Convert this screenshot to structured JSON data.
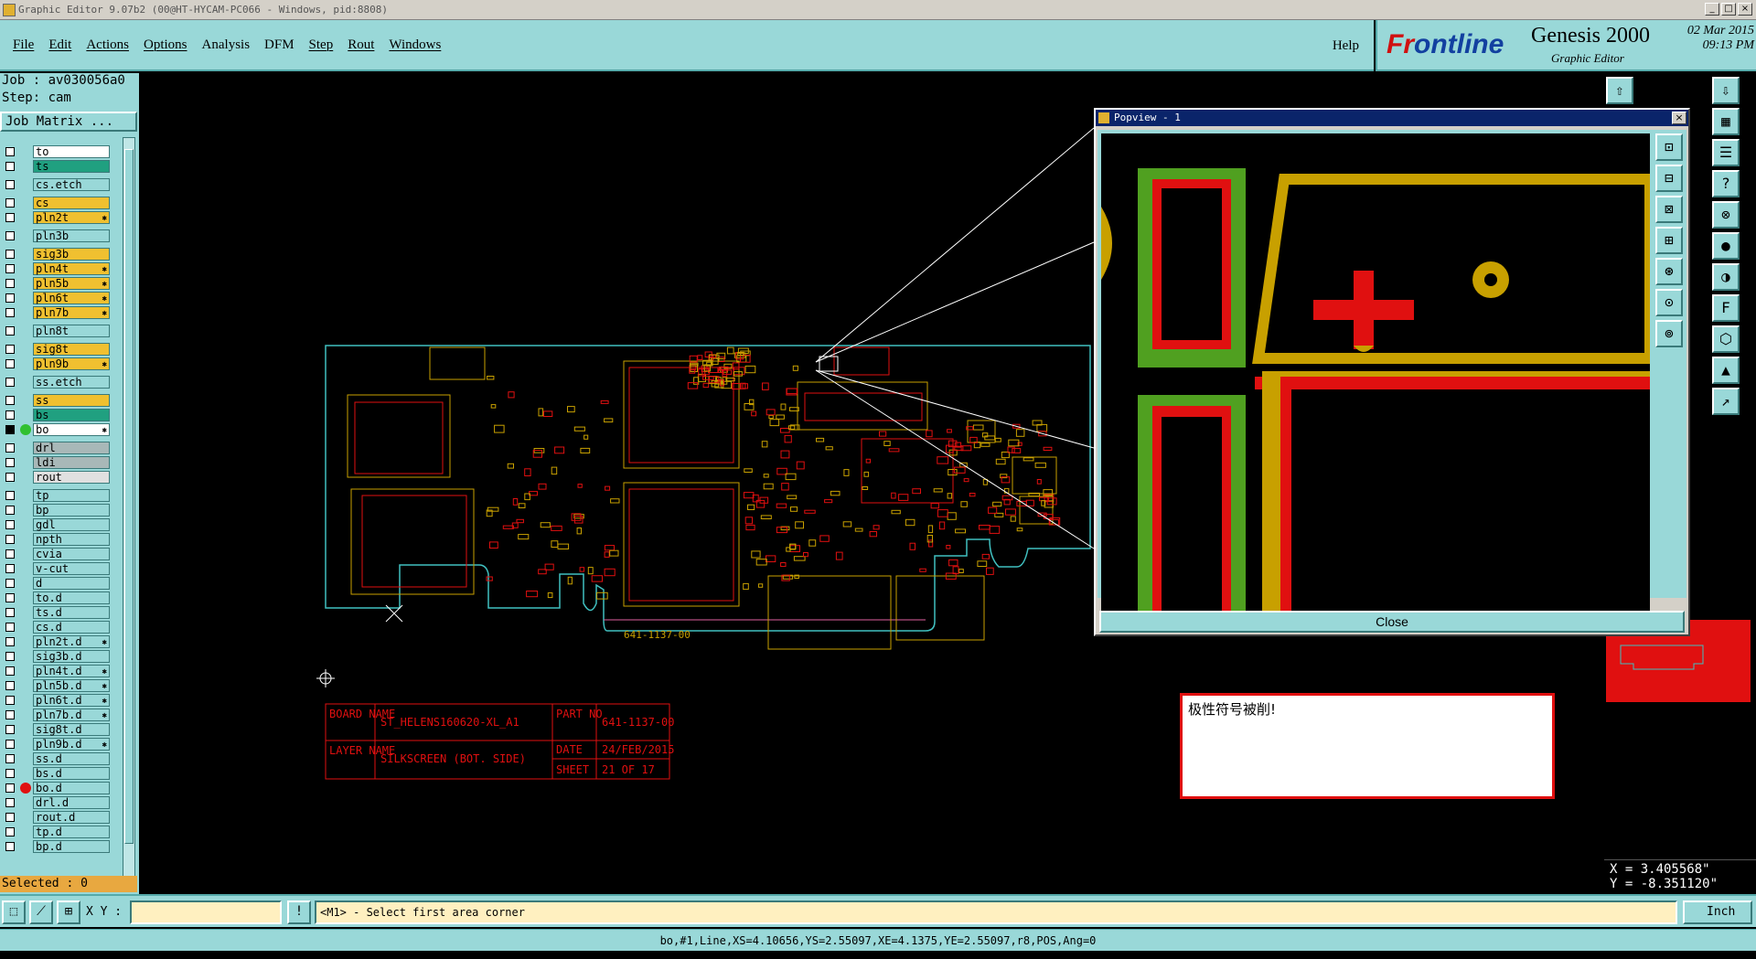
{
  "window": {
    "title": "Graphic Editor 9.07b2 (00@HT-HYCAM-PC066 - Windows, pid:8808)"
  },
  "menu": {
    "items": [
      "File",
      "Edit",
      "Actions",
      "Options",
      "Analysis",
      "DFM",
      "Step",
      "Rout",
      "Windows"
    ],
    "help": "Help"
  },
  "brand": {
    "logo_part1": "Fr",
    "logo_part2": "ontline",
    "product": "Genesis 2000",
    "subtitle": "Graphic Editor",
    "date": "02 Mar 2015",
    "time": "09:13 PM"
  },
  "job": {
    "job_label": "Job : av030056a0",
    "step_label": "Step: cam",
    "matrix_button": "Job Matrix ..."
  },
  "layers": [
    {
      "name": "to",
      "color": "#ffffff"
    },
    {
      "name": "ts",
      "color": "#20a080"
    },
    {
      "gap": true
    },
    {
      "name": "cs.etch",
      "color": "#99d8d8"
    },
    {
      "gap": true
    },
    {
      "name": "cs",
      "color": "#f0c030"
    },
    {
      "name": "pln2t",
      "color": "#f0c030",
      "star": true
    },
    {
      "gap": true
    },
    {
      "name": "pln3b",
      "color": "#99d8d8"
    },
    {
      "gap": true
    },
    {
      "name": "sig3b",
      "color": "#f0c030"
    },
    {
      "name": "pln4t",
      "color": "#f0c030",
      "star": true
    },
    {
      "name": "pln5b",
      "color": "#f0c030",
      "star": true
    },
    {
      "name": "pln6t",
      "color": "#f0c030",
      "star": true
    },
    {
      "name": "pln7b",
      "color": "#f0c030",
      "star": true
    },
    {
      "gap": true
    },
    {
      "name": "pln8t",
      "color": "#99d8d8"
    },
    {
      "gap": true
    },
    {
      "name": "sig8t",
      "color": "#f0c030"
    },
    {
      "name": "pln9b",
      "color": "#f0c030",
      "star": true
    },
    {
      "gap": true
    },
    {
      "name": "ss.etch",
      "color": "#99d8d8"
    },
    {
      "gap": true
    },
    {
      "name": "ss",
      "color": "#f0c030"
    },
    {
      "name": "bs",
      "color": "#20a080"
    },
    {
      "name": "bo",
      "color": "#ffffff",
      "dot": "#30c030",
      "star": true,
      "active": true
    },
    {
      "gap": true
    },
    {
      "name": "drl",
      "color": "#a8b8b8"
    },
    {
      "name": "ldi",
      "color": "#a8b8b8"
    },
    {
      "name": "rout",
      "color": "#e0e0e0"
    },
    {
      "gap": true
    },
    {
      "name": "tp",
      "color": "#99d8d8"
    },
    {
      "name": "bp",
      "color": "#99d8d8"
    },
    {
      "name": "gdl",
      "color": "#99d8d8"
    },
    {
      "name": "npth",
      "color": "#99d8d8"
    },
    {
      "name": "cvia",
      "color": "#99d8d8"
    },
    {
      "name": "v-cut",
      "color": "#99d8d8"
    },
    {
      "name": "d",
      "color": "#99d8d8"
    },
    {
      "name": "to.d",
      "color": "#99d8d8"
    },
    {
      "name": "ts.d",
      "color": "#99d8d8"
    },
    {
      "name": "cs.d",
      "color": "#99d8d8"
    },
    {
      "name": "pln2t.d",
      "color": "#99d8d8",
      "star": true
    },
    {
      "name": "sig3b.d",
      "color": "#99d8d8"
    },
    {
      "name": "pln4t.d",
      "color": "#99d8d8",
      "star": true
    },
    {
      "name": "pln5b.d",
      "color": "#99d8d8",
      "star": true
    },
    {
      "name": "pln6t.d",
      "color": "#99d8d8",
      "star": true
    },
    {
      "name": "pln7b.d",
      "color": "#99d8d8",
      "star": true
    },
    {
      "name": "sig8t.d",
      "color": "#99d8d8"
    },
    {
      "name": "pln9b.d",
      "color": "#99d8d8",
      "star": true
    },
    {
      "name": "ss.d",
      "color": "#99d8d8"
    },
    {
      "name": "bs.d",
      "color": "#99d8d8"
    },
    {
      "name": "bo.d",
      "color": "#99d8d8",
      "dot": "#e01010"
    },
    {
      "name": "drl.d",
      "color": "#99d8d8"
    },
    {
      "name": "rout.d",
      "color": "#99d8d8"
    },
    {
      "name": "tp.d",
      "color": "#99d8d8"
    },
    {
      "name": "bp.d",
      "color": "#99d8d8"
    }
  ],
  "selected": "Selected : 0",
  "titleblock": {
    "board_name_label": "BOARD NAME",
    "board_name": "ST_HELENS160620-XL_A1",
    "part_no_label": "PART NO",
    "part_no": "641-1137-00",
    "date_label": "DATE",
    "date": "24/FEB/2015",
    "layer_name_label": "LAYER NAME",
    "layer_name": "SILKSCREEN (BOT. SIDE)",
    "sheet_label": "SHEET",
    "sheet": "21 OF 17"
  },
  "board_label": "641-1137-00",
  "popview": {
    "title": "Popview - 1",
    "close_label": "Close"
  },
  "message": "极性符号被削!",
  "coords": {
    "x": "X = 3.405568\"",
    "y": "Y = -8.351120\""
  },
  "bottom": {
    "xy_label": "X Y :",
    "xy_value": "",
    "prompt": "<M1> - Select first area corner",
    "units": "Inch"
  },
  "status": "bo,#1,Line,XS=4.10656,YS=2.55097,XE=4.1375,YE=2.55097,r8,POS,Ang=0",
  "colors": {
    "panel": "#99d8d8",
    "accent": "#e01010",
    "board_outline": "#40c0c0",
    "pad_yellow": "#c8a000",
    "pad_green": "#50a020"
  }
}
